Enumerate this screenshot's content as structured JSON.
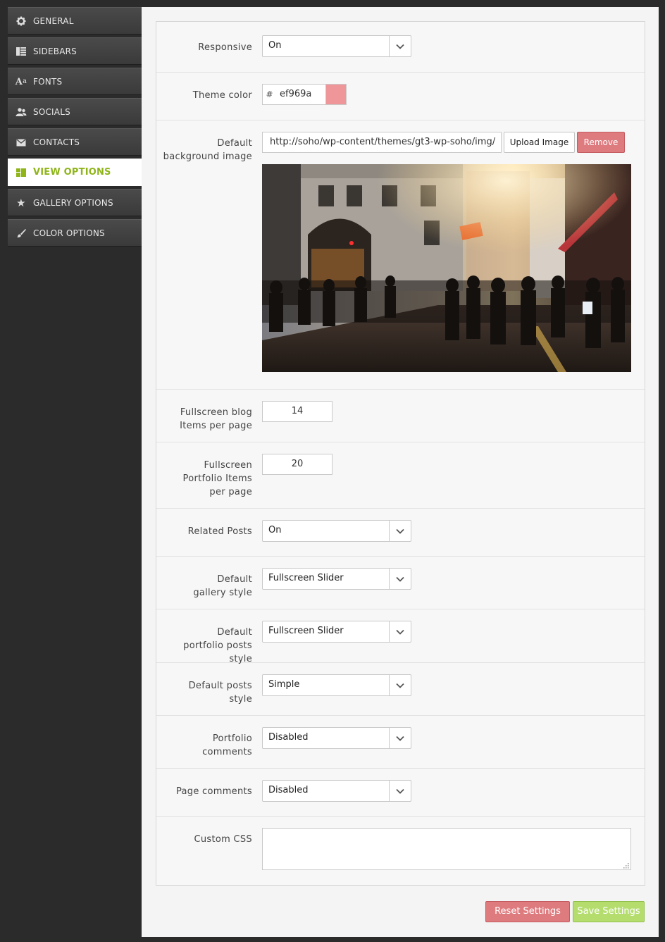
{
  "sidebar": {
    "items": [
      {
        "label": "GENERAL",
        "icon": "gear-icon"
      },
      {
        "label": "SIDEBARS",
        "icon": "sidebar-icon"
      },
      {
        "label": "FONTS",
        "icon": "font-icon"
      },
      {
        "label": "SOCIALS",
        "icon": "users-icon"
      },
      {
        "label": "CONTACTS",
        "icon": "envelope-icon"
      },
      {
        "label": "VIEW OPTIONS",
        "icon": "layout-icon",
        "active": true
      },
      {
        "label": "GALLERY OPTIONS",
        "icon": "star-icon"
      },
      {
        "label": "COLOR OPTIONS",
        "icon": "brush-icon"
      }
    ]
  },
  "settings": {
    "responsive": {
      "label": "Responsive",
      "value": "On"
    },
    "theme_color": {
      "label": "Theme color",
      "hash": "#",
      "value": "ef969a",
      "swatch": "#ef969a"
    },
    "bg_image": {
      "label": "Default background image",
      "url": "http://soho/wp-content/themes/gt3-wp-soho/img/",
      "upload_label": "Upload Image",
      "remove_label": "Remove"
    },
    "blog_items": {
      "label": "Fullscreen blog Items per page",
      "value": "14"
    },
    "portfolio_items": {
      "label": "Fullscreen Portfolio Items per page",
      "value": "20"
    },
    "related_posts": {
      "label": "Related Posts",
      "value": "On"
    },
    "gallery_style": {
      "label": "Default gallery style",
      "value": "Fullscreen Slider"
    },
    "portfolio_style": {
      "label": "Default portfolio posts style",
      "value": "Fullscreen Slider"
    },
    "posts_style": {
      "label": "Default posts style",
      "value": "Simple"
    },
    "portfolio_comments": {
      "label": "Portfolio comments",
      "value": "Disabled"
    },
    "page_comments": {
      "label": "Page comments",
      "value": "Disabled"
    },
    "custom_css": {
      "label": "Custom CSS",
      "value": ""
    }
  },
  "footer": {
    "reset_label": "Reset Settings",
    "save_label": "Save Settings"
  },
  "colors": {
    "accent": "#8fb51a",
    "remove": "#de7b7f",
    "save": "#b4dd6e"
  }
}
